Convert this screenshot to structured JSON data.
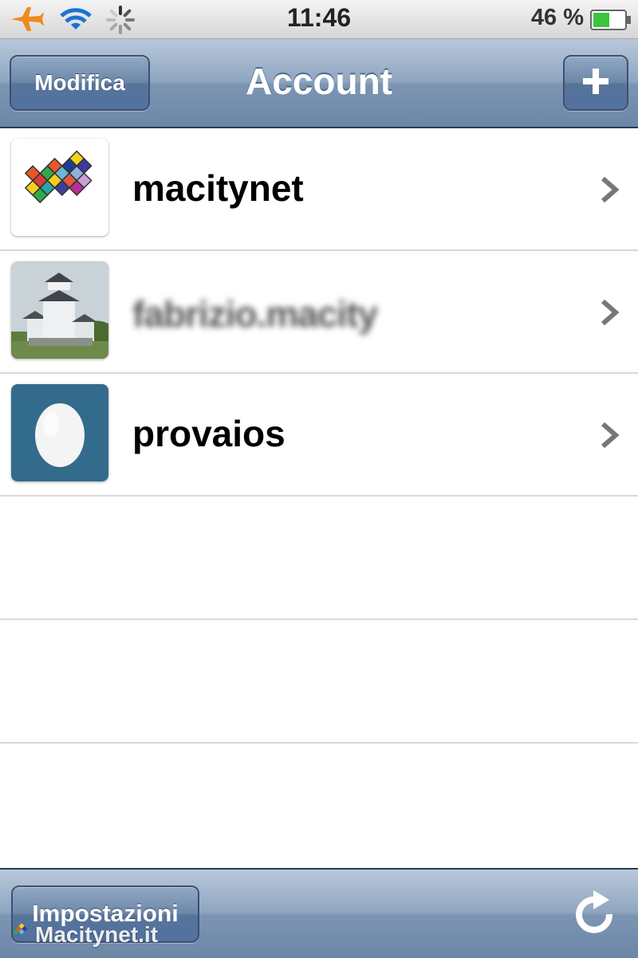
{
  "status_bar": {
    "time": "11:46",
    "battery_percent": "46 %",
    "icons": [
      "airplane-icon",
      "wifi-icon",
      "activity-spinner-icon",
      "battery-icon"
    ]
  },
  "nav_bar": {
    "title": "Account",
    "edit_label": "Modifica",
    "add_icon": "plus-icon"
  },
  "accounts": [
    {
      "name": "macitynet",
      "avatar": "macitynet-logo"
    },
    {
      "name": "fabrizio.macity",
      "avatar": "castle-photo",
      "blurred": true
    },
    {
      "name": "provaios",
      "avatar": "default-egg"
    }
  ],
  "toolbar": {
    "settings_label": "Impostazioni",
    "refresh_icon": "refresh-icon"
  },
  "watermark": "Macitynet.it",
  "colors": {
    "bar_blue": "#7c95b3",
    "airplane_orange": "#f08a1c",
    "wifi_blue": "#1a73d6",
    "battery_green": "#3cc43c",
    "egg_bg": "#336b8c"
  }
}
